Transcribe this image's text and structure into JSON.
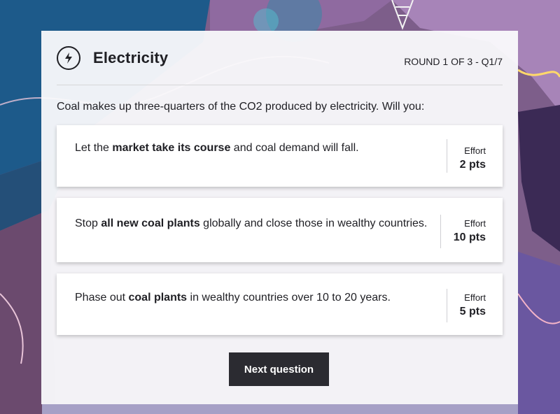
{
  "colors": {
    "card_bg": "#fafafc",
    "text": "#1f1f24",
    "button_bg": "#2b2b31",
    "button_text": "#ffffff",
    "bg_purple": "#7a5c86",
    "bg_blue": "#1d5a8a"
  },
  "header": {
    "icon": "lightning-bolt-icon",
    "title": "Electricity",
    "round_label": "ROUND 1 OF 3 - Q1/7"
  },
  "question": {
    "prompt": "Coal makes up three-quarters of the CO2 produced by electricity. Will you:"
  },
  "options": [
    {
      "text_before": "Let the ",
      "text_bold": "market take its course",
      "text_after": " and coal demand will fall.",
      "effort_label": "Effort",
      "effort_points": "2 pts"
    },
    {
      "text_before": "Stop ",
      "text_bold": "all new coal plants",
      "text_after": " globally and close those in wealthy countries.",
      "effort_label": "Effort",
      "effort_points": "10 pts"
    },
    {
      "text_before": "Phase out ",
      "text_bold": "coal plants",
      "text_after": " in wealthy countries over 10 to 20 years.",
      "effort_label": "Effort",
      "effort_points": "5 pts"
    }
  ],
  "footer": {
    "next_label": "Next question"
  }
}
